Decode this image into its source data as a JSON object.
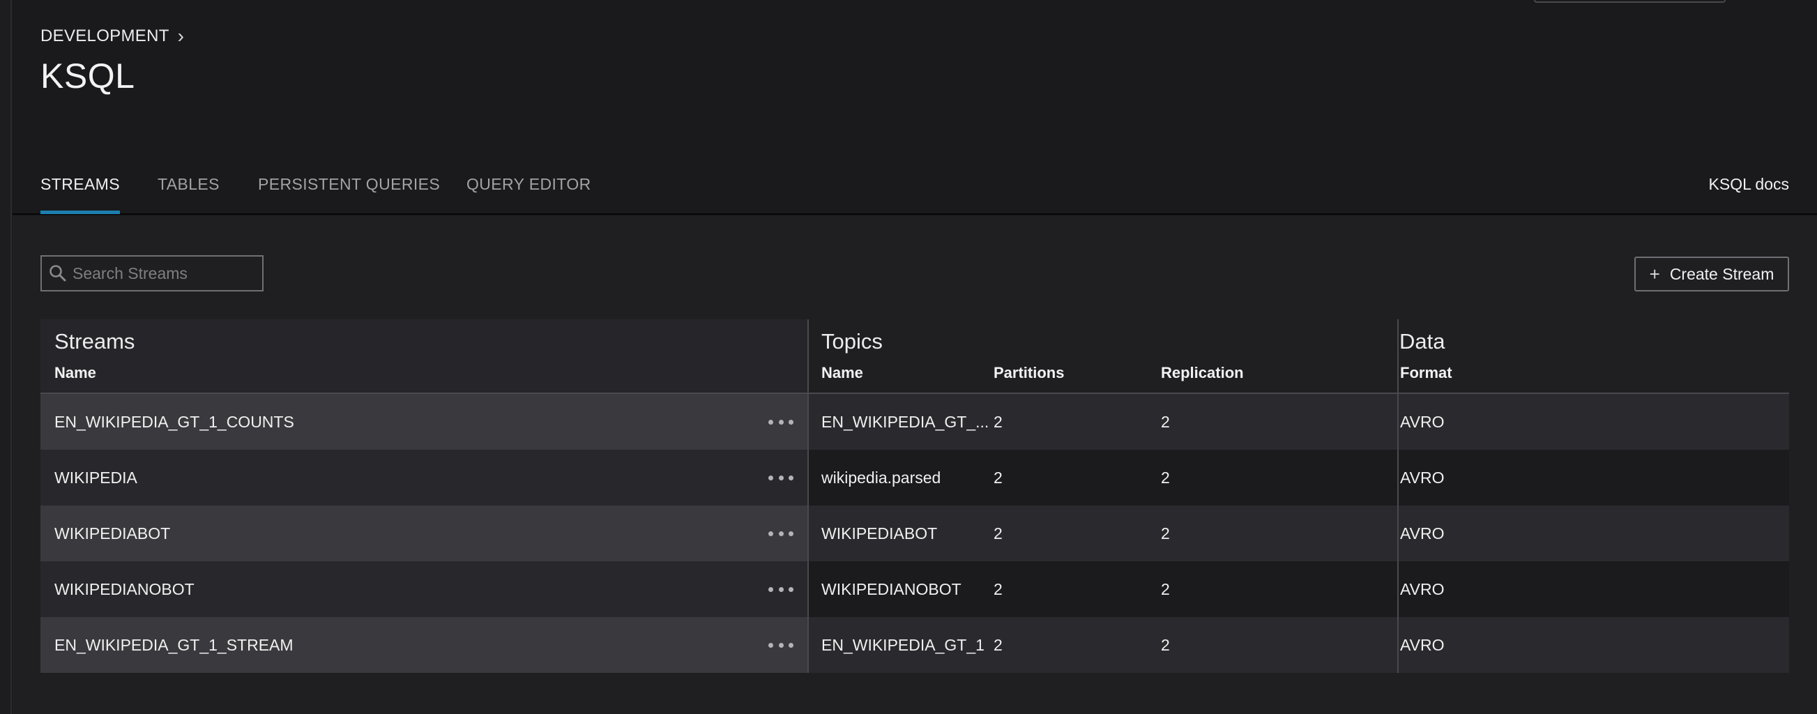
{
  "header": {
    "breadcrumb": "DEVELOPMENT",
    "breadcrumb_chevron": "›",
    "title": "KSQL"
  },
  "tabs": [
    {
      "label": "STREAMS",
      "active": true
    },
    {
      "label": "TABLES",
      "active": false
    },
    {
      "label": "PERSISTENT QUERIES",
      "active": false
    },
    {
      "label": "QUERY EDITOR",
      "active": false
    }
  ],
  "docs_link": "KSQL docs",
  "search": {
    "placeholder": "Search Streams",
    "value": "",
    "icon": "search-icon"
  },
  "create_button": {
    "icon": "plus-icon",
    "glyph": "+",
    "label": "Create Stream"
  },
  "table": {
    "sections": {
      "streams": "Streams",
      "topics": "Topics",
      "data": "Data"
    },
    "columns": {
      "stream_name": "Name",
      "topic_name": "Name",
      "partitions": "Partitions",
      "replication": "Replication",
      "format": "Format"
    },
    "rows": [
      {
        "stream": "EN_WIKIPEDIA_GT_1_COUNTS",
        "topic": "EN_WIKIPEDIA_GT_...",
        "partitions": "2",
        "replication": "2",
        "format": "AVRO"
      },
      {
        "stream": "WIKIPEDIA",
        "topic": "wikipedia.parsed",
        "partitions": "2",
        "replication": "2",
        "format": "AVRO"
      },
      {
        "stream": "WIKIPEDIABOT",
        "topic": "WIKIPEDIABOT",
        "partitions": "2",
        "replication": "2",
        "format": "AVRO"
      },
      {
        "stream": "WIKIPEDIANOBOT",
        "topic": "WIKIPEDIANOBOT",
        "partitions": "2",
        "replication": "2",
        "format": "AVRO"
      },
      {
        "stream": "EN_WIKIPEDIA_GT_1_STREAM",
        "topic": "EN_WIKIPEDIA_GT_1",
        "partitions": "2",
        "replication": "2",
        "format": "AVRO"
      }
    ]
  },
  "colors": {
    "accent": "#1c7fb0",
    "background": "#1a1a1c"
  }
}
